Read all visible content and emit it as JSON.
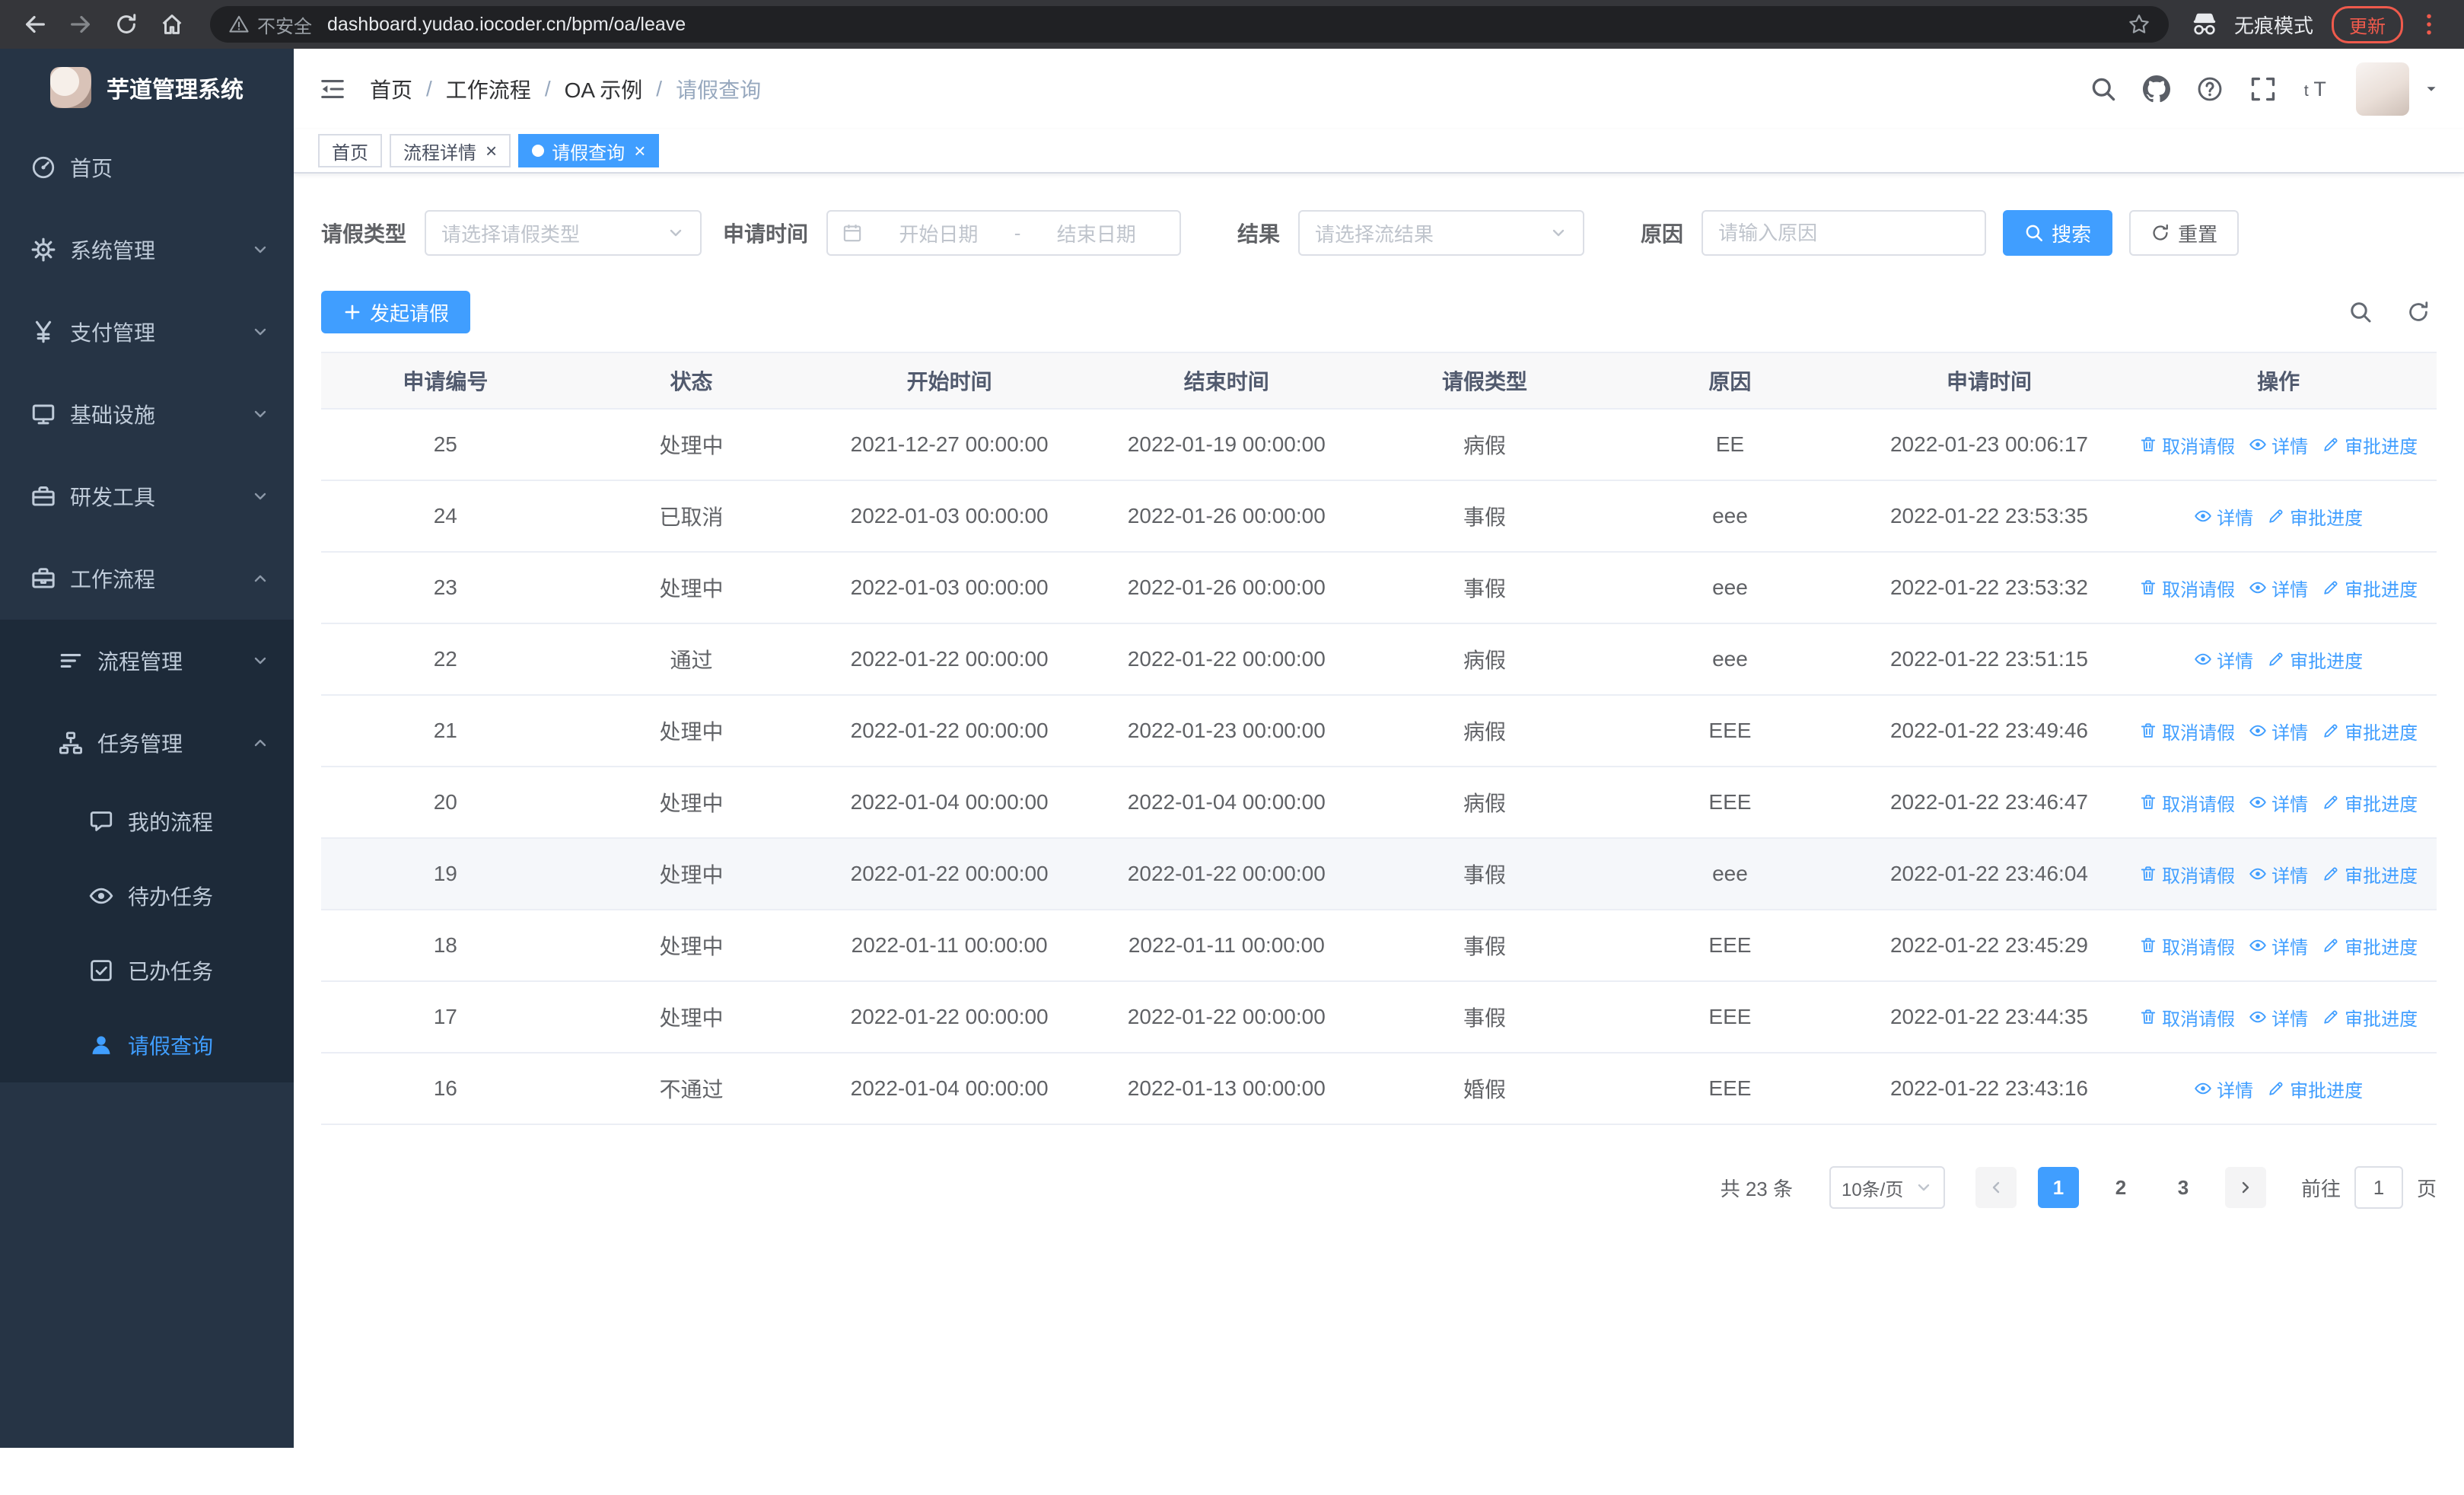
{
  "browser": {
    "security_warning": "不安全",
    "url": "dashboard.yudao.iocoder.cn/bpm/oa/leave",
    "incognito_label": "无痕模式",
    "update_button": "更新"
  },
  "sidebar": {
    "logo_title": "芋道管理系统",
    "items": [
      {
        "key": "home",
        "label": "首页",
        "icon": "dashboard-icon",
        "level": 1,
        "chevron": null,
        "active": false
      },
      {
        "key": "system",
        "label": "系统管理",
        "icon": "gear-icon",
        "level": 1,
        "chevron": "down",
        "active": false
      },
      {
        "key": "payment",
        "label": "支付管理",
        "icon": "yen-icon",
        "level": 1,
        "chevron": "down",
        "active": false
      },
      {
        "key": "infrastructure",
        "label": "基础设施",
        "icon": "monitor-icon",
        "level": 1,
        "chevron": "down",
        "active": false
      },
      {
        "key": "devtools",
        "label": "研发工具",
        "icon": "toolbox-icon",
        "level": 1,
        "chevron": "down",
        "active": false
      },
      {
        "key": "workflow",
        "label": "工作流程",
        "icon": "briefcase-icon",
        "level": 1,
        "chevron": "up",
        "active": false
      },
      {
        "key": "process-mgmt",
        "label": "流程管理",
        "icon": "list-icon",
        "level": 2,
        "chevron": "down",
        "active": false
      },
      {
        "key": "task-mgmt",
        "label": "任务管理",
        "icon": "org-icon",
        "level": 2,
        "chevron": "up",
        "active": false
      },
      {
        "key": "my-process",
        "label": "我的流程",
        "icon": "chat-icon",
        "level": 3,
        "chevron": null,
        "active": false
      },
      {
        "key": "todo-task",
        "label": "待办任务",
        "icon": "eye-icon",
        "level": 3,
        "chevron": null,
        "active": false
      },
      {
        "key": "done-task",
        "label": "已办任务",
        "icon": "checksquare-icon",
        "level": 3,
        "chevron": null,
        "active": false
      },
      {
        "key": "leave-query",
        "label": "请假查询",
        "icon": "user-icon",
        "level": 3,
        "chevron": null,
        "active": true
      }
    ]
  },
  "header": {
    "breadcrumb": [
      "首页",
      "工作流程",
      "OA 示例",
      "请假查询"
    ]
  },
  "tabs": [
    {
      "key": "home",
      "label": "首页",
      "closable": false,
      "active": false
    },
    {
      "key": "process-detail",
      "label": "流程详情",
      "closable": true,
      "active": false
    },
    {
      "key": "leave-query",
      "label": "请假查询",
      "closable": true,
      "active": true
    }
  ],
  "filters": {
    "leave_type_label": "请假类型",
    "leave_type_placeholder": "请选择请假类型",
    "apply_time_label": "申请时间",
    "start_date_placeholder": "开始日期",
    "date_separator": "-",
    "end_date_placeholder": "结束日期",
    "result_label": "结果",
    "result_placeholder": "请选择流结果",
    "reason_label": "原因",
    "reason_placeholder": "请输入原因",
    "search_button": "搜索",
    "reset_button": "重置"
  },
  "toolbar": {
    "create_button": "发起请假"
  },
  "table": {
    "columns": [
      "申请编号",
      "状态",
      "开始时间",
      "结束时间",
      "请假类型",
      "原因",
      "申请时间",
      "操作"
    ],
    "actions": {
      "cancel": "取消请假",
      "detail": "详情",
      "progress": "审批进度"
    },
    "rows": [
      {
        "id": "25",
        "status": "处理中",
        "start_time": "2021-12-27 00:00:00",
        "end_time": "2022-01-19 00:00:00",
        "leave_type": "病假",
        "reason": "EE",
        "apply_time": "2022-01-23 00:06:17",
        "can_cancel": true,
        "highlight": false
      },
      {
        "id": "24",
        "status": "已取消",
        "start_time": "2022-01-03 00:00:00",
        "end_time": "2022-01-26 00:00:00",
        "leave_type": "事假",
        "reason": "eee",
        "apply_time": "2022-01-22 23:53:35",
        "can_cancel": false,
        "highlight": false
      },
      {
        "id": "23",
        "status": "处理中",
        "start_time": "2022-01-03 00:00:00",
        "end_time": "2022-01-26 00:00:00",
        "leave_type": "事假",
        "reason": "eee",
        "apply_time": "2022-01-22 23:53:32",
        "can_cancel": true,
        "highlight": false
      },
      {
        "id": "22",
        "status": "通过",
        "start_time": "2022-01-22 00:00:00",
        "end_time": "2022-01-22 00:00:00",
        "leave_type": "病假",
        "reason": "eee",
        "apply_time": "2022-01-22 23:51:15",
        "can_cancel": false,
        "highlight": false
      },
      {
        "id": "21",
        "status": "处理中",
        "start_time": "2022-01-22 00:00:00",
        "end_time": "2022-01-23 00:00:00",
        "leave_type": "病假",
        "reason": "EEE",
        "apply_time": "2022-01-22 23:49:46",
        "can_cancel": true,
        "highlight": false
      },
      {
        "id": "20",
        "status": "处理中",
        "start_time": "2022-01-04 00:00:00",
        "end_time": "2022-01-04 00:00:00",
        "leave_type": "病假",
        "reason": "EEE",
        "apply_time": "2022-01-22 23:46:47",
        "can_cancel": true,
        "highlight": false
      },
      {
        "id": "19",
        "status": "处理中",
        "start_time": "2022-01-22 00:00:00",
        "end_time": "2022-01-22 00:00:00",
        "leave_type": "事假",
        "reason": "eee",
        "apply_time": "2022-01-22 23:46:04",
        "can_cancel": true,
        "highlight": true
      },
      {
        "id": "18",
        "status": "处理中",
        "start_time": "2022-01-11 00:00:00",
        "end_time": "2022-01-11 00:00:00",
        "leave_type": "事假",
        "reason": "EEE",
        "apply_time": "2022-01-22 23:45:29",
        "can_cancel": true,
        "highlight": false
      },
      {
        "id": "17",
        "status": "处理中",
        "start_time": "2022-01-22 00:00:00",
        "end_time": "2022-01-22 00:00:00",
        "leave_type": "事假",
        "reason": "EEE",
        "apply_time": "2022-01-22 23:44:35",
        "can_cancel": true,
        "highlight": false
      },
      {
        "id": "16",
        "status": "不通过",
        "start_time": "2022-01-04 00:00:00",
        "end_time": "2022-01-13 00:00:00",
        "leave_type": "婚假",
        "reason": "EEE",
        "apply_time": "2022-01-22 23:43:16",
        "can_cancel": false,
        "highlight": false
      }
    ]
  },
  "pagination": {
    "total_text": "共 23 条",
    "page_size": "10条/页",
    "pages": [
      "1",
      "2",
      "3"
    ],
    "active_page": "1",
    "goto_label": "前往",
    "goto_value": "1",
    "goto_suffix": "页"
  },
  "colors": {
    "primary": "#409eff"
  }
}
